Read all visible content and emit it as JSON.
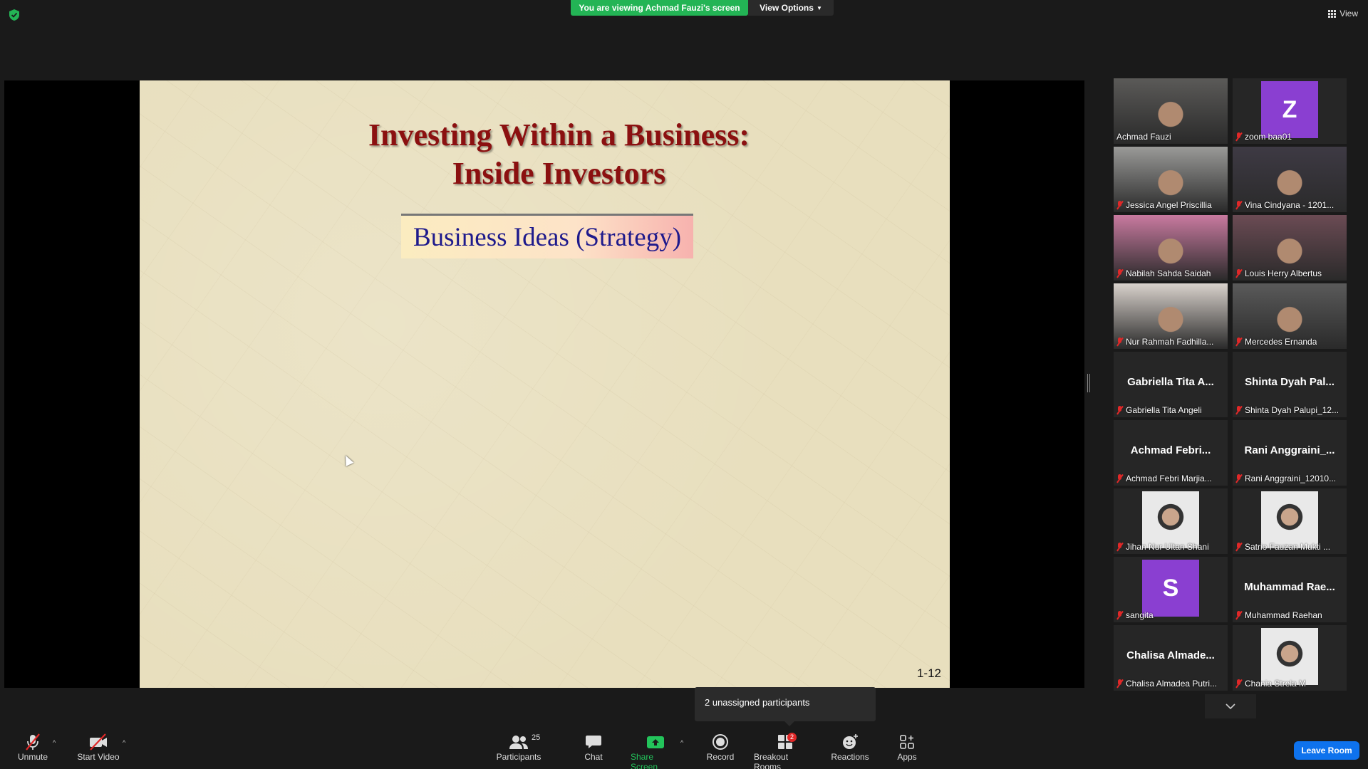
{
  "top": {
    "viewing_banner": "You are viewing Achmad Fauzi's screen",
    "view_options": "View Options",
    "view": "View"
  },
  "slide": {
    "title_line1": "Investing Within a Business:",
    "title_line2": "Inside Investors",
    "box_text": "Business Ideas (Strategy)",
    "number": "1-12"
  },
  "gallery": [
    {
      "label": "Achmad Fauzi",
      "kind": "video",
      "muted": false,
      "active": true
    },
    {
      "label": "zoom baa01",
      "kind": "avatar",
      "initial": "Z",
      "avatar_color": "#8a3fd1",
      "muted": true
    },
    {
      "label": "Jessica Angel Priscillia",
      "kind": "video",
      "muted": true
    },
    {
      "label": "Vina Cindyana - 1201...",
      "kind": "video",
      "muted": true
    },
    {
      "label": "Nabilah Sahda Saidah",
      "kind": "video",
      "muted": true
    },
    {
      "label": "Louis Herry Albertus",
      "kind": "video",
      "muted": true
    },
    {
      "label": "Nur Rahmah Fadhilla...",
      "kind": "video",
      "muted": true
    },
    {
      "label": "Mercedes Ernanda",
      "kind": "video",
      "muted": true
    },
    {
      "label": "Gabriella Tita Angeli",
      "kind": "name",
      "bigname": "Gabriella Tita A...",
      "muted": true
    },
    {
      "label": "Shinta Dyah Palupi_12...",
      "kind": "name",
      "bigname": "Shinta Dyah Pal...",
      "muted": true
    },
    {
      "label": "Achmad Febri Marjia...",
      "kind": "name",
      "bigname": "Achmad Febri...",
      "muted": true
    },
    {
      "label": "Rani Anggraini_12010...",
      "kind": "name",
      "bigname": "Rani Anggraini_...",
      "muted": true
    },
    {
      "label": "Jihan Nur Ultan Shani",
      "kind": "photo",
      "muted": true
    },
    {
      "label": "Satrio Fauzan Mukti ...",
      "kind": "photo",
      "muted": true
    },
    {
      "label": "sangita",
      "kind": "avatar",
      "initial": "S",
      "avatar_color": "#8a3fd1",
      "muted": true
    },
    {
      "label": "Muhammad Raehan",
      "kind": "name",
      "bigname": "Muhammad Rae...",
      "muted": true
    },
    {
      "label": "Chalisa Almadea Putri...",
      "kind": "name",
      "bigname": "Chalisa Almade...",
      "muted": true
    },
    {
      "label": "Chania Strela M",
      "kind": "photo",
      "muted": true
    }
  ],
  "tooltip": "2 unassigned participants",
  "toolbar": {
    "unmute": "Unmute",
    "start_video": "Start Video",
    "participants": "Participants",
    "participants_count": "25",
    "chat": "Chat",
    "share_screen": "Share Screen",
    "record": "Record",
    "breakout_rooms": "Breakout Rooms",
    "breakout_badge": "2",
    "reactions": "Reactions",
    "apps": "Apps",
    "leave_room": "Leave Room"
  },
  "colors": {
    "banner_green": "#23b455",
    "leave_blue": "#0e72ed",
    "active_border": "#c4d64a",
    "mute_red": "#e02828"
  }
}
